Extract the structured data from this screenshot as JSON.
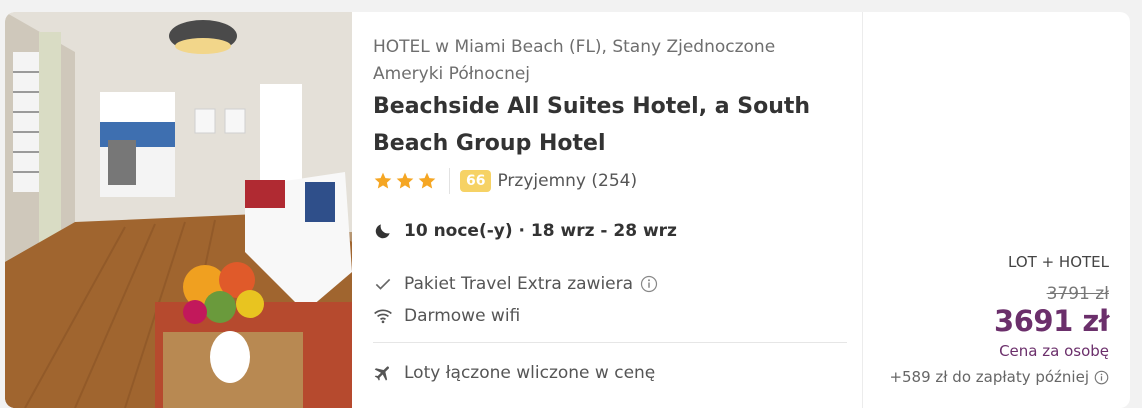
{
  "hotel": {
    "location": "HOTEL w Miami Beach (FL), Stany Zjednoczone Ameryki Północnej",
    "name": "Beachside All Suites Hotel, a South Beach Group Hotel",
    "stars": 3,
    "score": "66",
    "score_text": "Przyjemny (254)",
    "stay": "10 noce(-y) · 18 wrz - 28 wrz",
    "features": [
      {
        "icon": "check-icon",
        "label": "Pakiet Travel Extra zawiera",
        "has_info": true
      },
      {
        "icon": "wifi-icon",
        "label": "Darmowe wifi"
      }
    ],
    "flights": {
      "icon": "plane-icon",
      "label": "Loty łączone wliczone w cenę"
    }
  },
  "price": {
    "package": "LOT + HOTEL",
    "old_price": "3791 zł",
    "new_price": "3691 zł",
    "per_person": "Cena za osobę",
    "pay_later": "+589 zł do zapłaty później"
  },
  "colors": {
    "star": "#f5a623",
    "score_bg": "#f6d265",
    "price_accent": "#6b2f6b"
  }
}
